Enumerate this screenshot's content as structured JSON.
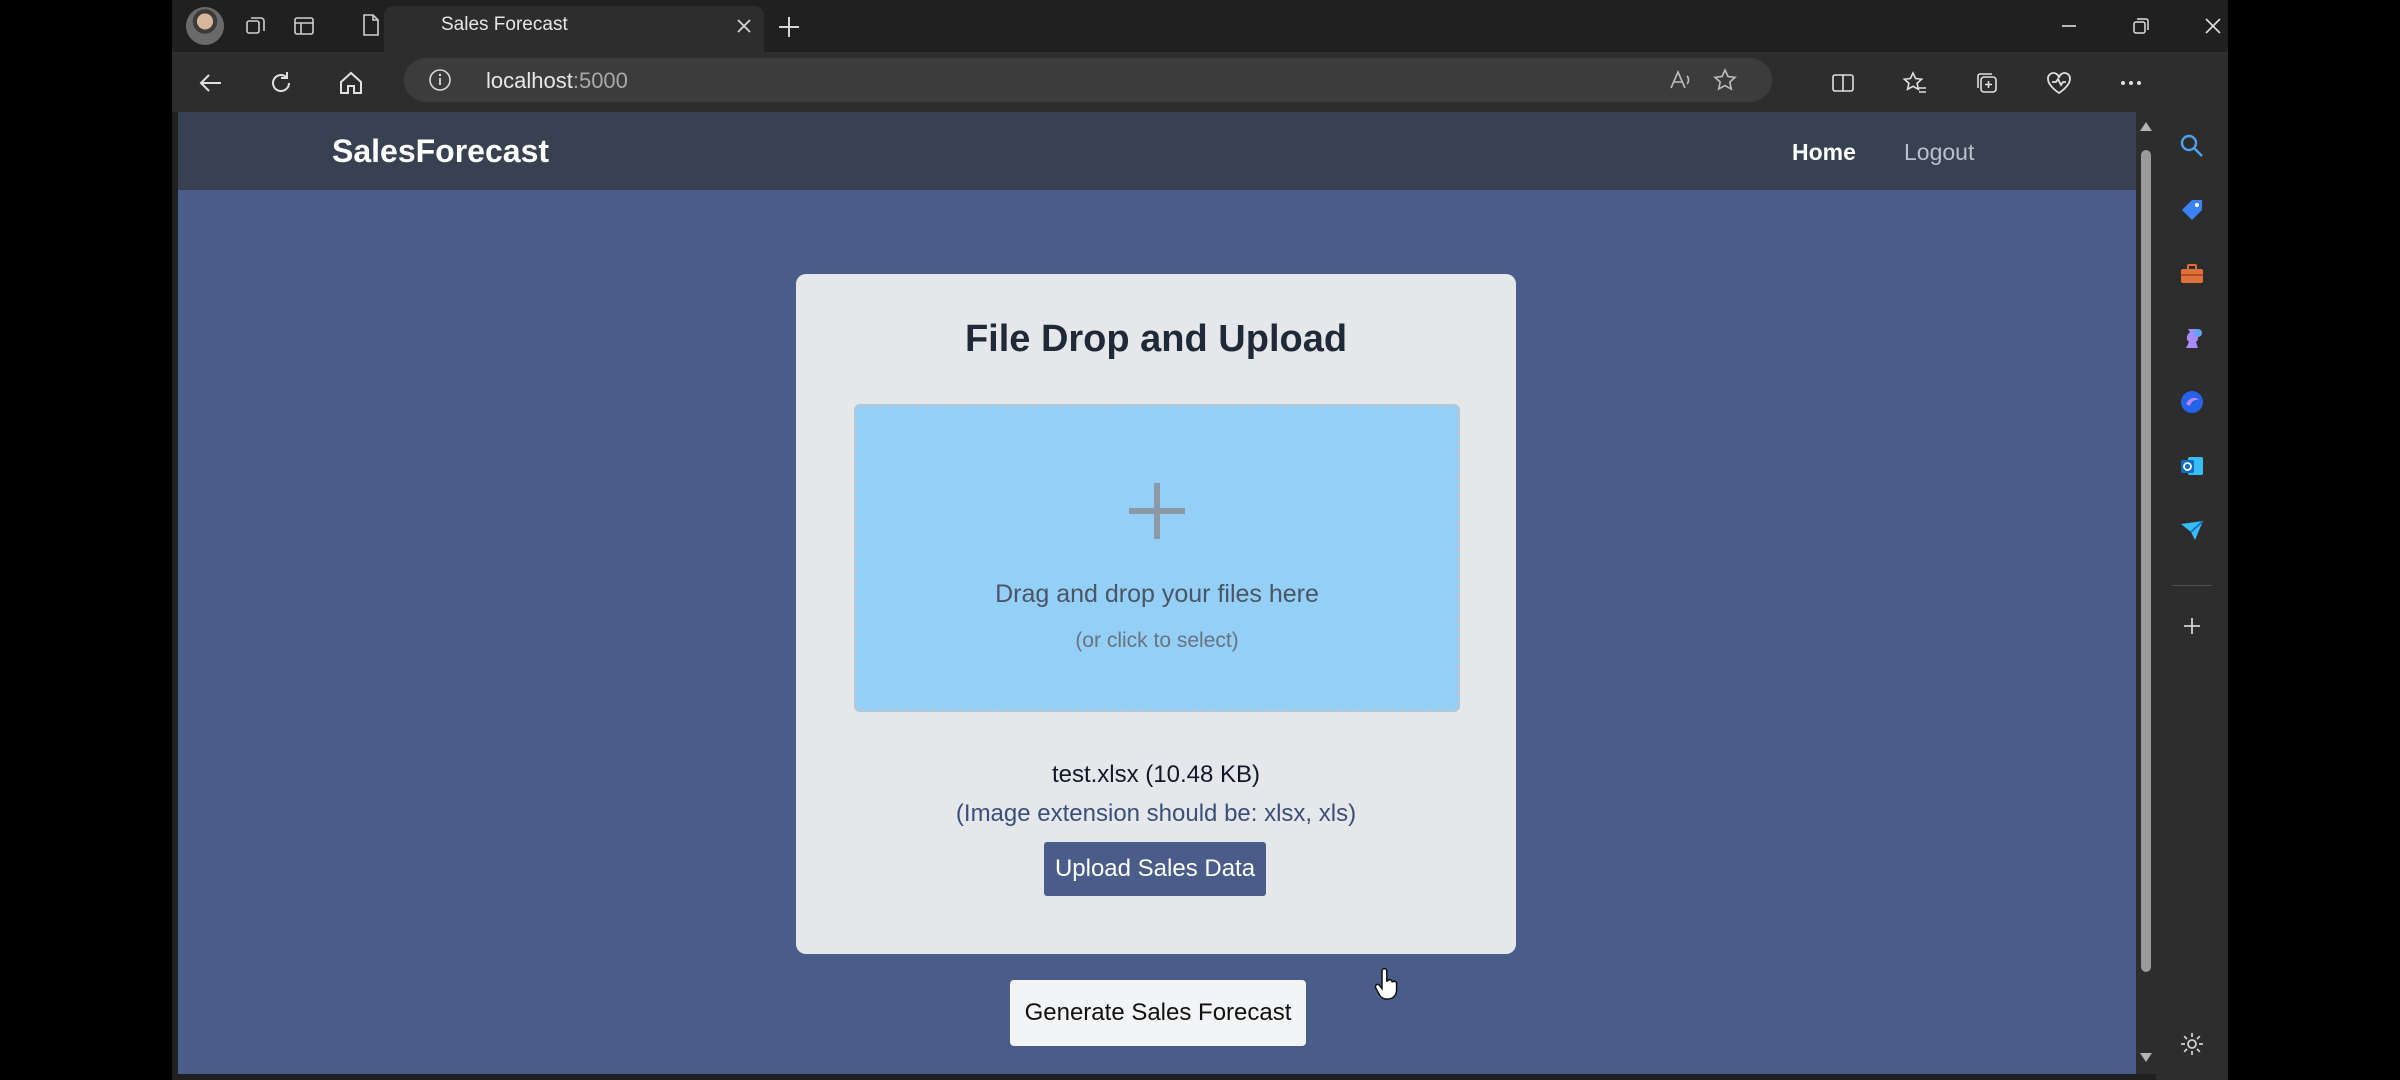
{
  "browser": {
    "tab_title": "Sales Forecast",
    "url_host": "localhost",
    "url_port": ":5000"
  },
  "page": {
    "navbar": {
      "brand": "SalesForecast",
      "links": [
        "Home",
        "Logout"
      ]
    },
    "card": {
      "title": "File Drop and Upload",
      "dropzone_text": "Drag and drop your files here",
      "dropzone_subtext": "(or click to select)",
      "file_info": "test.xlsx (10.48 KB)",
      "extension_note": "(Image extension should be: xlsx, xls)",
      "upload_button": "Upload Sales Data"
    },
    "forecast_button": "Generate Sales Forecast"
  },
  "colors": {
    "page_bg": "#4a5d8a",
    "navbar_bg": "#374151",
    "card_bg": "#e5e7eb",
    "dropzone_bg": "#93cff6",
    "upload_button_bg": "#4a5d8a"
  }
}
